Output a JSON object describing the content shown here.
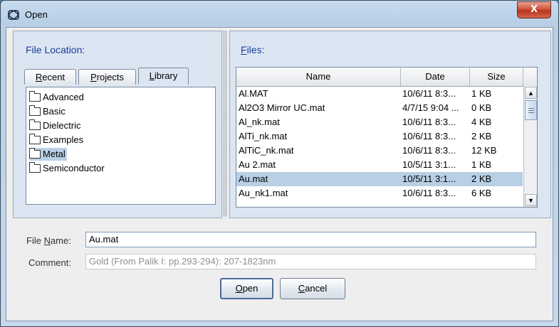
{
  "window": {
    "title": "Open",
    "close_label": "X"
  },
  "left_panel": {
    "label": "File Location:",
    "tabs": [
      {
        "label": "Recent",
        "mnemonic": "R",
        "rest": "ecent"
      },
      {
        "label": "Projects",
        "mnemonic": "P",
        "rest": "rojects"
      },
      {
        "label": "Library",
        "mnemonic": "L",
        "rest": "ibrary"
      }
    ],
    "active_tab": "Library",
    "folders": [
      "Advanced",
      "Basic",
      "Dielectric",
      "Examples",
      "Metal",
      "Semiconductor"
    ],
    "selected_folder": "Metal"
  },
  "right_panel": {
    "label": "Files:",
    "label_mnemonic": "F",
    "label_rest": "iles:",
    "columns": [
      "Name",
      "Date",
      "Size"
    ],
    "rows": [
      {
        "name": "Al.MAT",
        "date": "10/6/11 8:3...",
        "size": "1 KB"
      },
      {
        "name": "Al2O3 Mirror UC.mat",
        "date": "4/7/15 9:04 ...",
        "size": "0 KB"
      },
      {
        "name": "Al_nk.mat",
        "date": "10/6/11 8:3...",
        "size": "4 KB"
      },
      {
        "name": "AlTi_nk.mat",
        "date": "10/6/11 8:3...",
        "size": "2 KB"
      },
      {
        "name": "AlTiC_nk.mat",
        "date": "10/6/11 8:3...",
        "size": "12 KB"
      },
      {
        "name": "Au 2.mat",
        "date": "10/5/11 3:1...",
        "size": "1 KB"
      },
      {
        "name": "Au.mat",
        "date": "10/5/11 3:1...",
        "size": "2 KB"
      },
      {
        "name": "Au_nk1.mat",
        "date": "10/6/11 8:3...",
        "size": "6 KB"
      }
    ],
    "selected_row": 6
  },
  "form": {
    "file_name_label_mnemonic": "N",
    "file_name_label_pre": "File ",
    "file_name_label_post": "ame:",
    "file_name_value": "Au.mat",
    "comment_label": "Comment:",
    "comment_value": "Gold (From Palik I: pp.293-294):  207-1823nm"
  },
  "buttons": {
    "open": {
      "mnemonic": "O",
      "rest": "pen"
    },
    "cancel": {
      "mnemonic": "C",
      "rest": "ancel"
    }
  },
  "colors": {
    "accent": "#1b3c9b",
    "selection": "#b8cfe5",
    "panel": "#dce6f3",
    "close": "#c8432a"
  }
}
